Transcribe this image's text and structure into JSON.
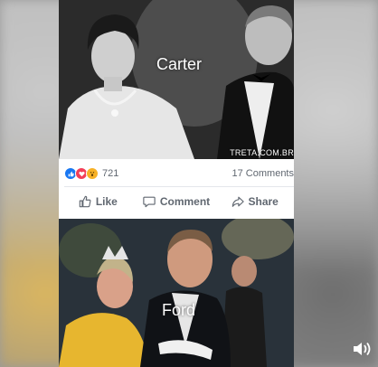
{
  "photo_top": {
    "caption": "Carter",
    "watermark": "TRETA.COM.BR"
  },
  "post_footer": {
    "reactions": [
      "like-icon",
      "love-icon",
      "wow-icon"
    ],
    "reaction_count": "721",
    "comments_label": "17 Comments",
    "actions": {
      "like": "Like",
      "comment": "Comment",
      "share": "Share"
    }
  },
  "photo_bottom": {
    "caption": "Ford"
  },
  "colors": {
    "like_blue": "#1877f2",
    "love_red": "#f33e58",
    "wow_yellow": "#f7b125",
    "text_gray": "#606770"
  }
}
